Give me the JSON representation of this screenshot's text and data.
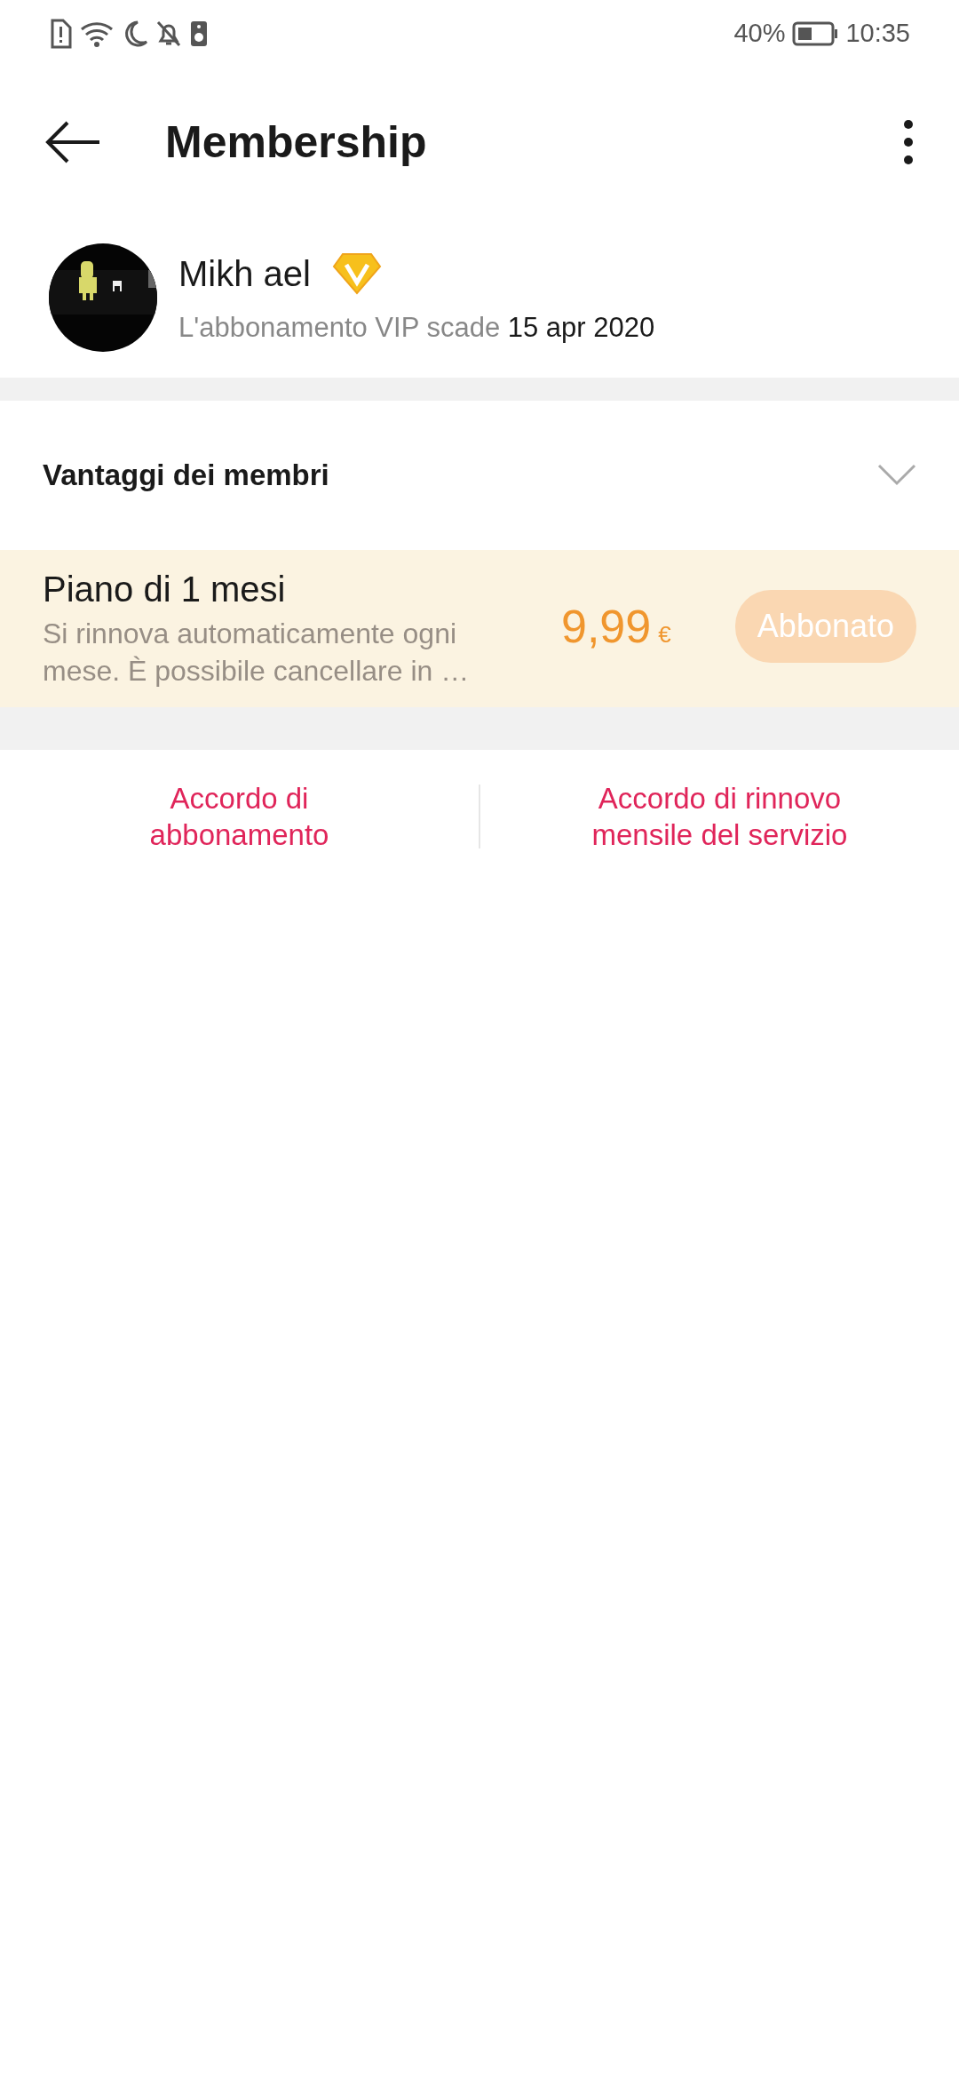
{
  "status_bar": {
    "battery_percent": "40%",
    "time": "10:35"
  },
  "app_bar": {
    "title": "Membership"
  },
  "profile": {
    "name": "Mikh ael",
    "expiry_label": "L'abbonamento VIP scade",
    "expiry_date": "15 apr 2020"
  },
  "benefits": {
    "title": "Vantaggi dei membri",
    "expanded": false
  },
  "plan": {
    "title": "Piano di 1 mesi",
    "description": "Si rinnova automaticamente ogni mese. È possibile cancellare in …",
    "price": "9,99",
    "currency": "€",
    "button": {
      "label": "Abbonato",
      "disabled": true
    }
  },
  "links": [
    "Accordo di abbonamento",
    "Accordo di rinnovo mensile del servizio"
  ]
}
